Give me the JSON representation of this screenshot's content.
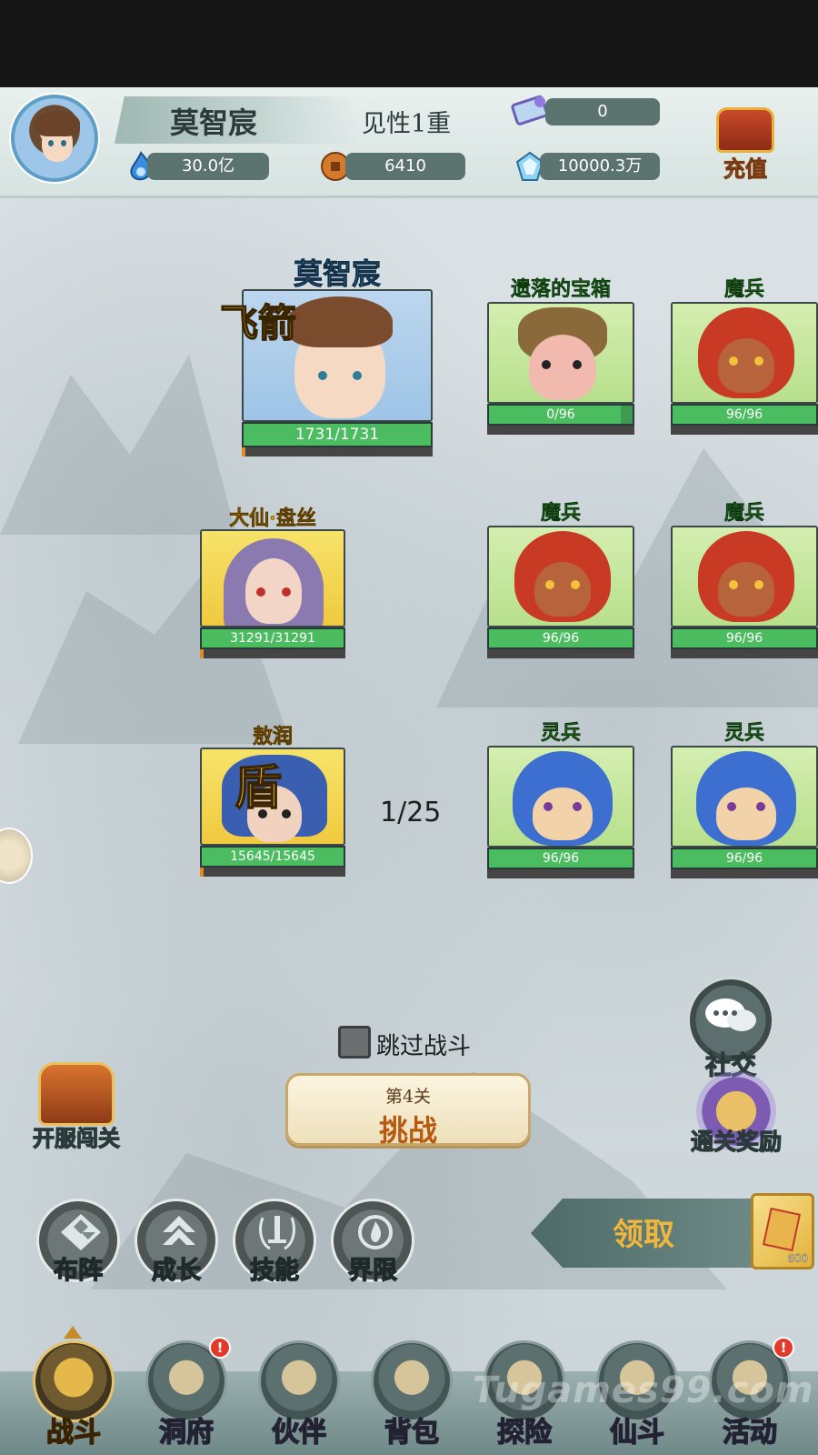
{
  "player": {
    "name": "莫智宸",
    "rank": "见性1重"
  },
  "resources": {
    "ticket": "0",
    "spirit": "30.0亿",
    "coins": "6410",
    "gems": "10000.3万"
  },
  "recharge_label": "充值",
  "allies": [
    {
      "name": "莫智宸",
      "hp": "1731/1731",
      "tag": "飞箭"
    },
    {
      "name": "大仙·盘丝",
      "hp": "31291/31291"
    },
    {
      "name": "敖润",
      "hp": "15645/15645",
      "tag": "盾"
    }
  ],
  "enemies": [
    {
      "name": "遗落的宝箱",
      "hp": "0/96",
      "hp_fraction": 0.92
    },
    {
      "name": "魔兵",
      "hp": "96/96",
      "hp_fraction": 1
    },
    {
      "name": "魔兵",
      "hp": "96/96",
      "hp_fraction": 1
    },
    {
      "name": "魔兵",
      "hp": "96/96",
      "hp_fraction": 1
    },
    {
      "name": "灵兵",
      "hp": "96/96",
      "hp_fraction": 1
    },
    {
      "name": "灵兵",
      "hp": "96/96",
      "hp_fraction": 1
    }
  ],
  "wave_counter": "1/25",
  "skip_battle_label": "跳过战斗",
  "challenge": {
    "stage": "第4关",
    "label": "挑战"
  },
  "side_buttons": {
    "open_server": "开服闯关",
    "social": "社交",
    "clear_rewards": "通关奖励"
  },
  "claim_label": "领取",
  "coupon_count": "600",
  "action_buttons": [
    "布阵",
    "成长",
    "技能",
    "界限"
  ],
  "nav": [
    {
      "label": "战斗",
      "active": true,
      "badge": false
    },
    {
      "label": "洞府",
      "active": false,
      "badge": true
    },
    {
      "label": "伙伴",
      "active": false,
      "badge": false
    },
    {
      "label": "背包",
      "active": false,
      "badge": false
    },
    {
      "label": "探险",
      "active": false,
      "badge": false
    },
    {
      "label": "仙斗",
      "active": false,
      "badge": false
    },
    {
      "label": "活动",
      "active": false,
      "badge": true
    }
  ],
  "badge_glyph": "!",
  "watermark": "Tugames99.com",
  "colors": {
    "hp_green": "#4cbc60",
    "gold_text": "#f1b83a",
    "badge_red": "#e23a2a"
  }
}
